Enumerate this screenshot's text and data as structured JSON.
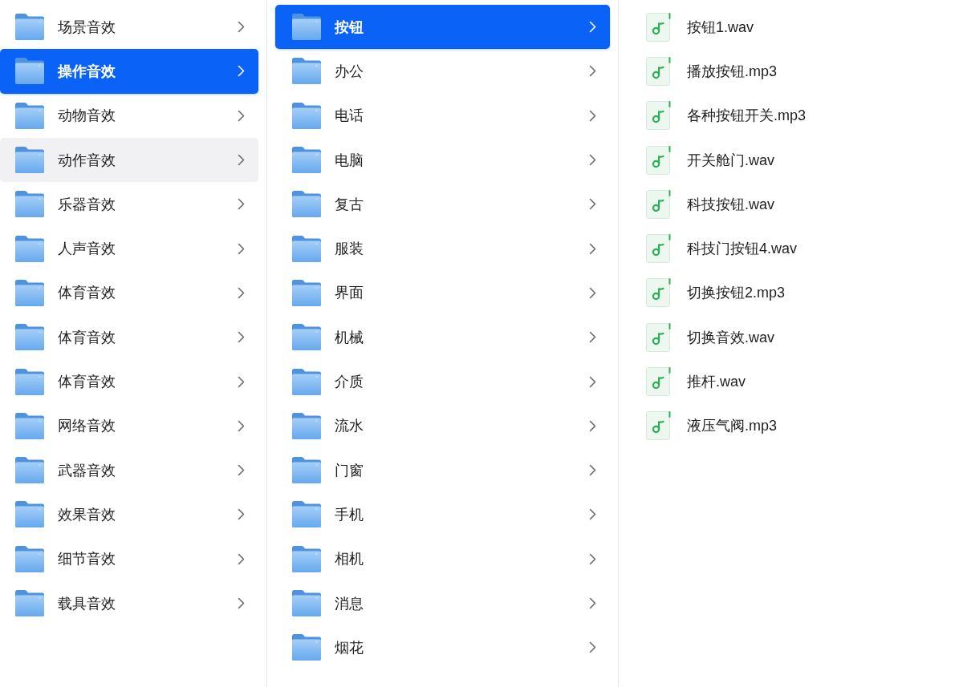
{
  "columns": [
    {
      "items": [
        {
          "label": "场景音效",
          "kind": "folder",
          "selected": false,
          "hovered": false
        },
        {
          "label": "操作音效",
          "kind": "folder",
          "selected": true,
          "hovered": false
        },
        {
          "label": "动物音效",
          "kind": "folder",
          "selected": false,
          "hovered": false
        },
        {
          "label": "动作音效",
          "kind": "folder",
          "selected": false,
          "hovered": true
        },
        {
          "label": "乐器音效",
          "kind": "folder",
          "selected": false,
          "hovered": false
        },
        {
          "label": "人声音效",
          "kind": "folder",
          "selected": false,
          "hovered": false
        },
        {
          "label": "体育音效",
          "kind": "folder",
          "selected": false,
          "hovered": false
        },
        {
          "label": "体育音效",
          "kind": "folder",
          "selected": false,
          "hovered": false
        },
        {
          "label": "体育音效",
          "kind": "folder",
          "selected": false,
          "hovered": false
        },
        {
          "label": "网络音效",
          "kind": "folder",
          "selected": false,
          "hovered": false
        },
        {
          "label": "武器音效",
          "kind": "folder",
          "selected": false,
          "hovered": false
        },
        {
          "label": "效果音效",
          "kind": "folder",
          "selected": false,
          "hovered": false
        },
        {
          "label": "细节音效",
          "kind": "folder",
          "selected": false,
          "hovered": false
        },
        {
          "label": "载具音效",
          "kind": "folder",
          "selected": false,
          "hovered": false
        }
      ]
    },
    {
      "items": [
        {
          "label": "按钮",
          "kind": "folder",
          "selected": true
        },
        {
          "label": "办公",
          "kind": "folder",
          "selected": false
        },
        {
          "label": "电话",
          "kind": "folder",
          "selected": false
        },
        {
          "label": "电脑",
          "kind": "folder",
          "selected": false
        },
        {
          "label": "复古",
          "kind": "folder",
          "selected": false
        },
        {
          "label": "服装",
          "kind": "folder",
          "selected": false
        },
        {
          "label": "界面",
          "kind": "folder",
          "selected": false
        },
        {
          "label": "机械",
          "kind": "folder",
          "selected": false
        },
        {
          "label": "介质",
          "kind": "folder",
          "selected": false
        },
        {
          "label": "流水",
          "kind": "folder",
          "selected": false
        },
        {
          "label": "门窗",
          "kind": "folder",
          "selected": false
        },
        {
          "label": "手机",
          "kind": "folder",
          "selected": false
        },
        {
          "label": "相机",
          "kind": "folder",
          "selected": false
        },
        {
          "label": "消息",
          "kind": "folder",
          "selected": false
        },
        {
          "label": "烟花",
          "kind": "folder",
          "selected": false
        }
      ]
    },
    {
      "items": [
        {
          "label": "按钮1.wav",
          "kind": "audio_file",
          "selected": false
        },
        {
          "label": "播放按钮.mp3",
          "kind": "audio_file",
          "selected": false
        },
        {
          "label": "各种按钮开关.mp3",
          "kind": "audio_file",
          "selected": false
        },
        {
          "label": "开关舱门.wav",
          "kind": "audio_file",
          "selected": false
        },
        {
          "label": "科技按钮.wav",
          "kind": "audio_file",
          "selected": false
        },
        {
          "label": "科技门按钮4.wav",
          "kind": "audio_file",
          "selected": false
        },
        {
          "label": "切换按钮2.mp3",
          "kind": "audio_file",
          "selected": false
        },
        {
          "label": "切换音效.wav",
          "kind": "audio_file",
          "selected": false
        },
        {
          "label": "推杆.wav",
          "kind": "audio_file",
          "selected": false
        },
        {
          "label": "液压气阀.mp3",
          "kind": "audio_file",
          "selected": false
        }
      ]
    }
  ]
}
